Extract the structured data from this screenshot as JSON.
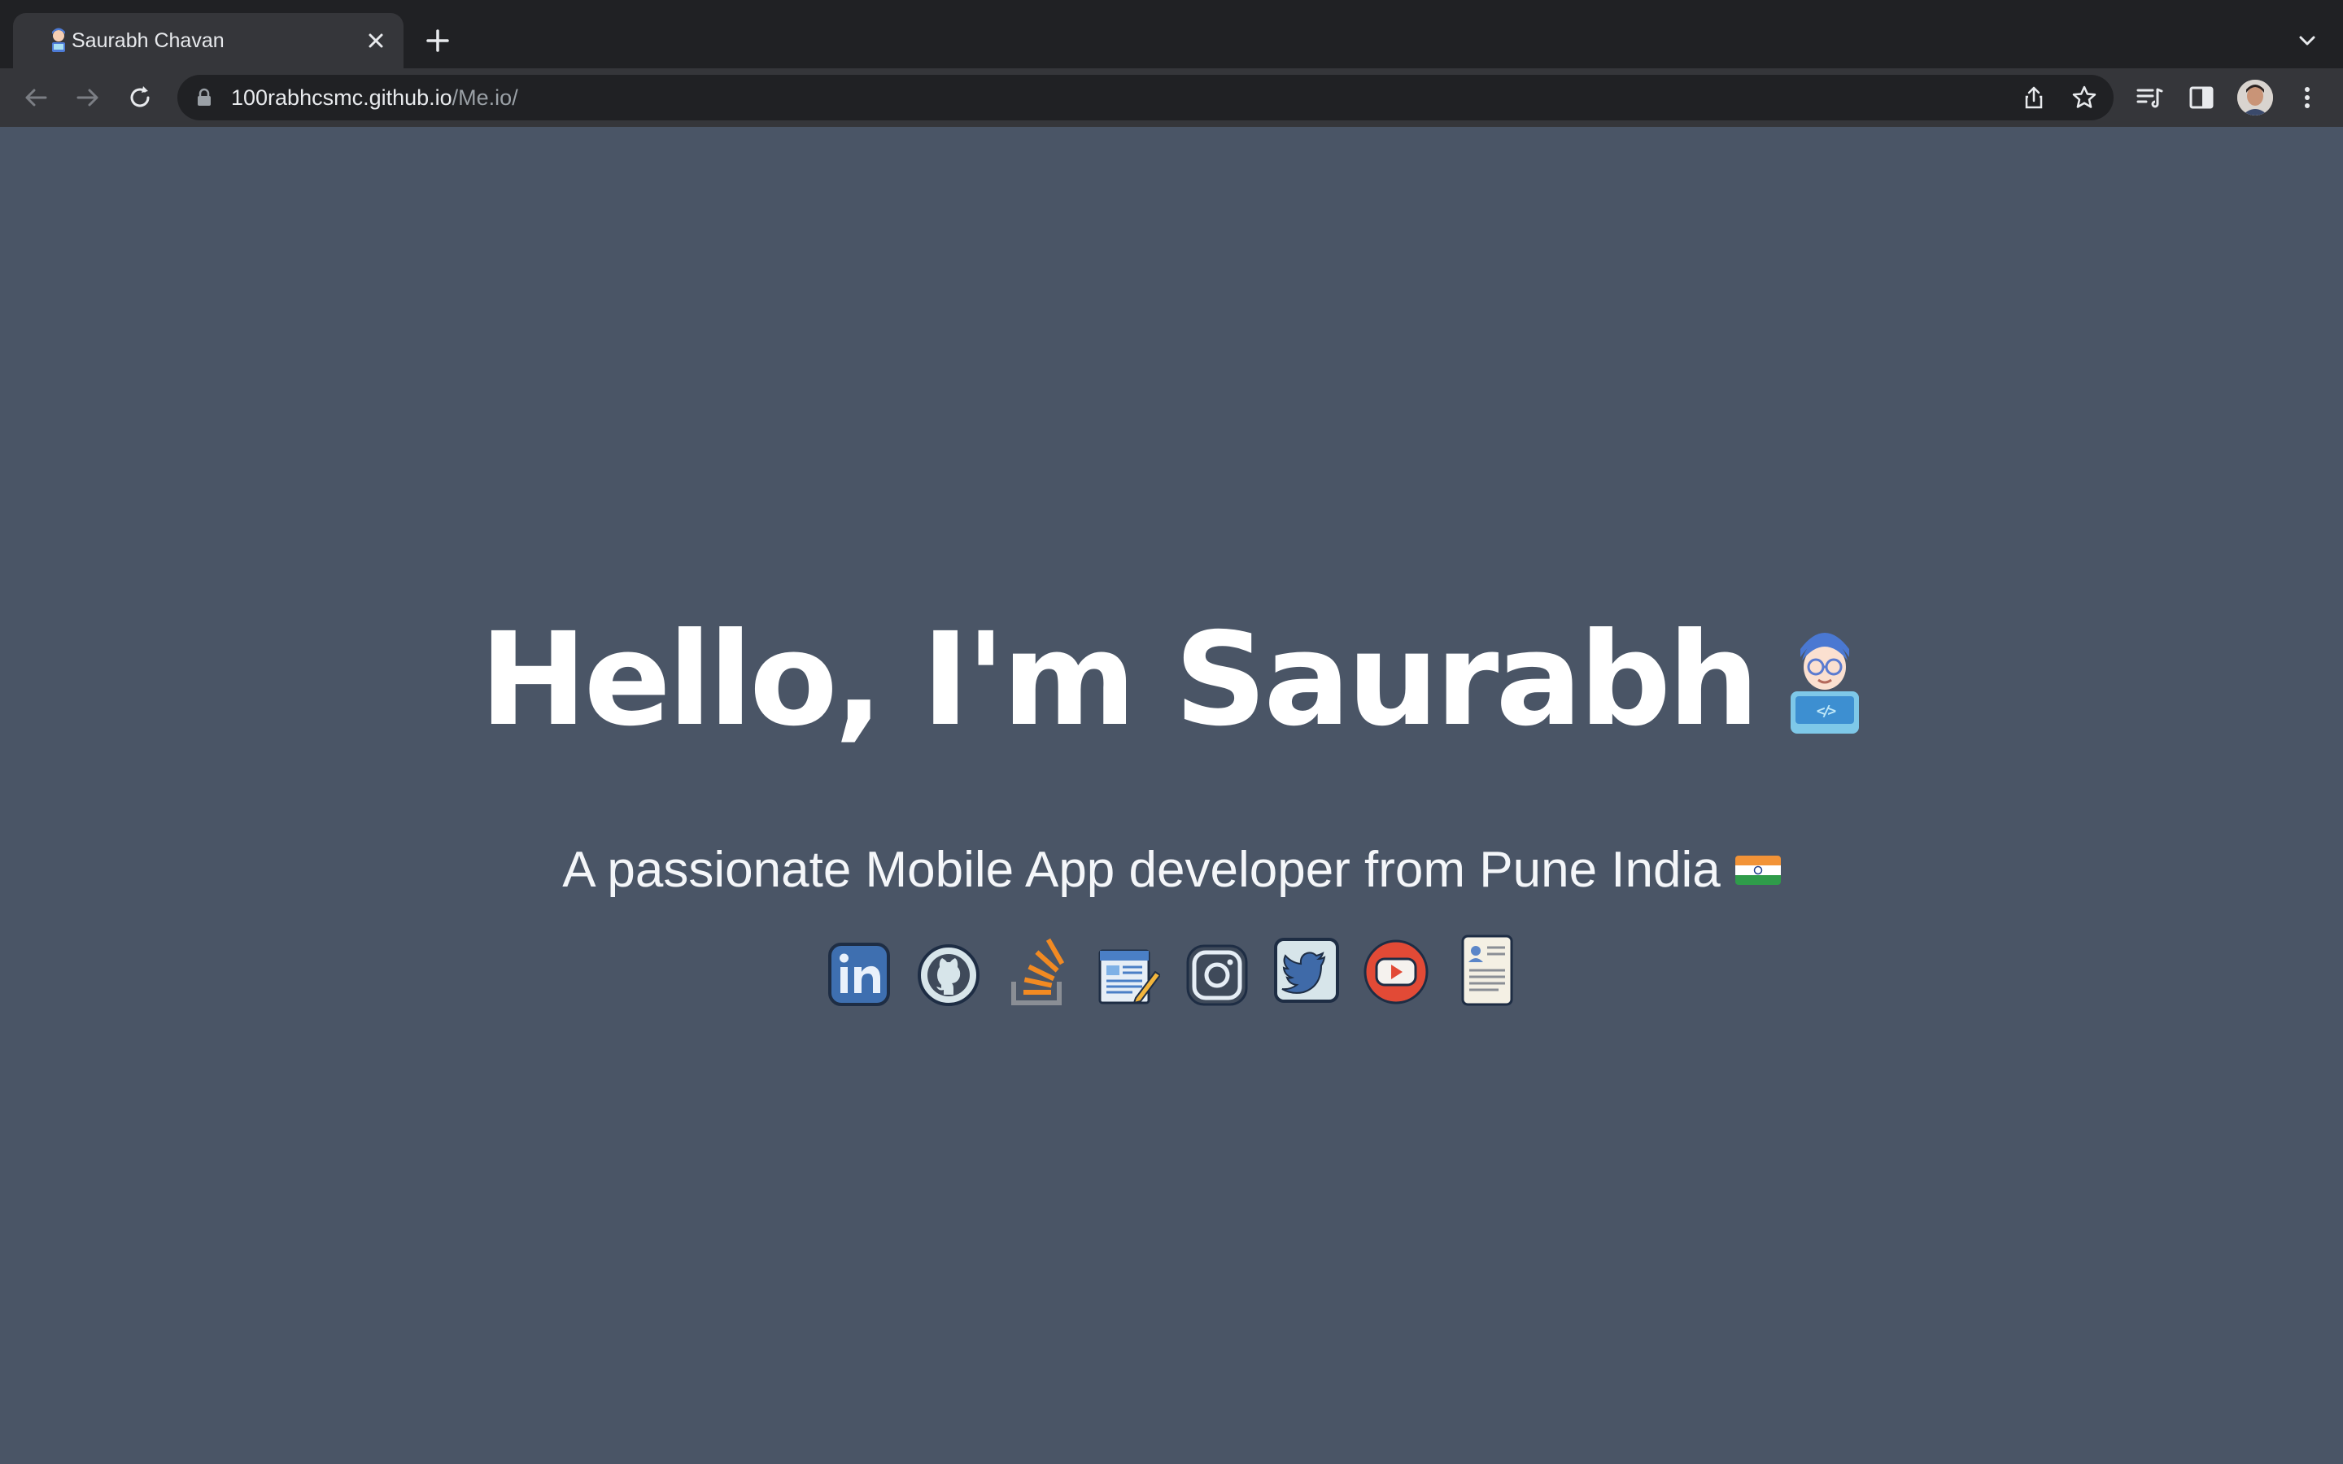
{
  "browser": {
    "tab_title": "Saurabh Chavan",
    "url_host": "100rabhcsmc.github.io",
    "url_path": "/Me.io/"
  },
  "hero": {
    "headline": "Hello, I'm Saurabh",
    "subtitle": "A passionate Mobile App developer from Pune India"
  },
  "social_links": [
    {
      "name": "linkedin",
      "icon": "linkedin-icon"
    },
    {
      "name": "github",
      "icon": "github-icon"
    },
    {
      "name": "stackoverflow",
      "icon": "stackoverflow-icon"
    },
    {
      "name": "blog",
      "icon": "blog-icon"
    },
    {
      "name": "instagram",
      "icon": "instagram-icon"
    },
    {
      "name": "twitter",
      "icon": "twitter-icon"
    },
    {
      "name": "youtube",
      "icon": "youtube-icon"
    },
    {
      "name": "resume",
      "icon": "resume-icon"
    }
  ],
  "colors": {
    "page_background": "#4a5566",
    "chrome_dark": "#202124",
    "chrome_toolbar": "#35363a",
    "text": "#ffffff"
  }
}
